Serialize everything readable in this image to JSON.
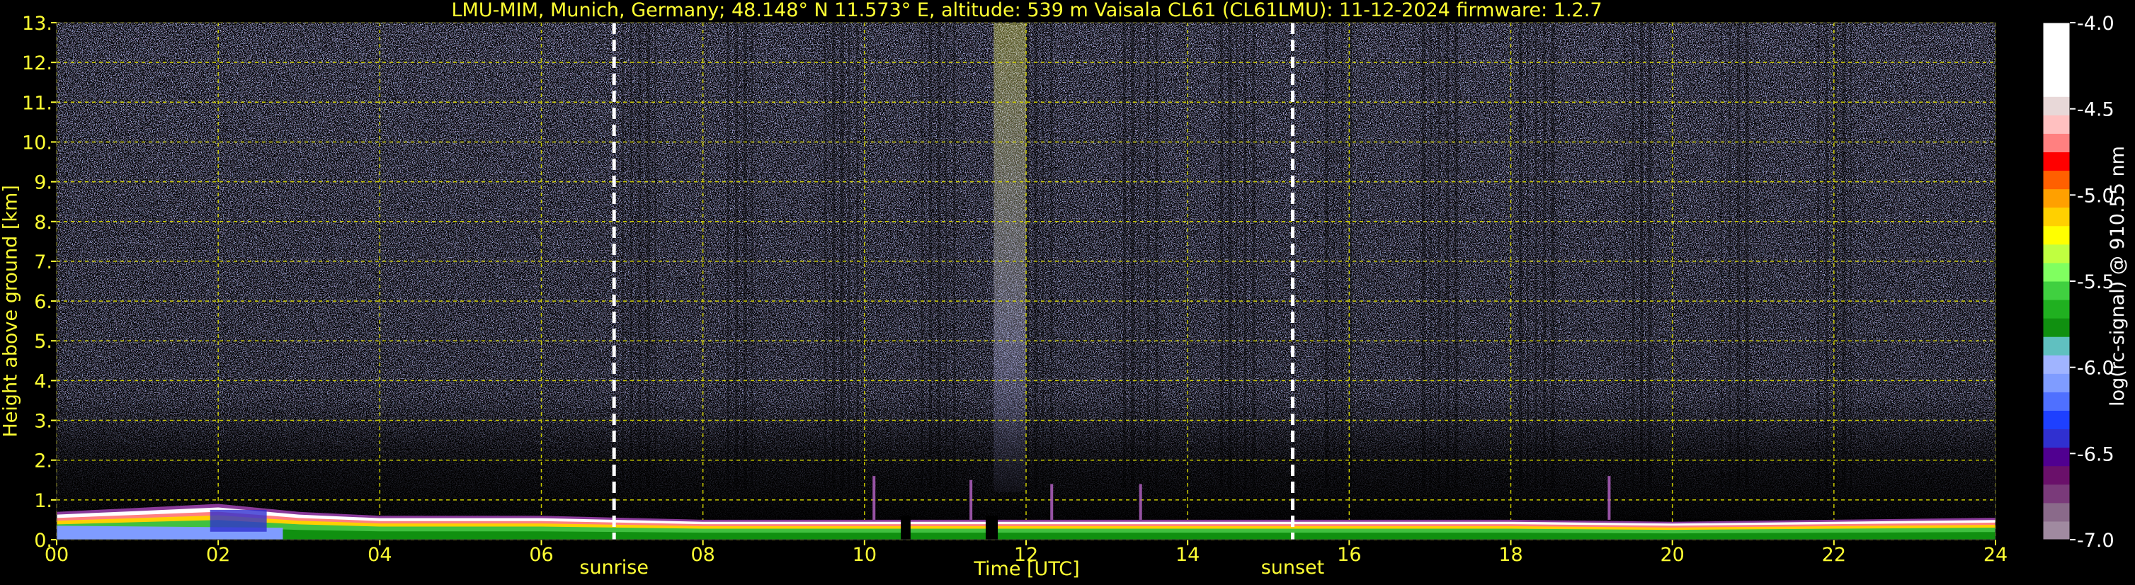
{
  "chart_data": {
    "type": "heatmap",
    "title": "LMU-MIM, Munich, Germany; 48.148° N 11.573° E, altitude: 539 m    Vaisala CL61 (CL61LMU): 11-12-2024    firmware: 1.2.7",
    "xlabel": "Time [UTC]",
    "ylabel": "Height above ground [km]",
    "xlim": [
      0,
      24
    ],
    "ylim": [
      0,
      13
    ],
    "x_ticks": [
      "00",
      "02",
      "04",
      "06",
      "08",
      "10",
      "12",
      "14",
      "16",
      "18",
      "20",
      "22",
      "24"
    ],
    "y_ticks": [
      "0.",
      "1.",
      "2.",
      "3.",
      "4.",
      "5.",
      "6.",
      "7.",
      "8.",
      "9.",
      "10.",
      "11.",
      "12.",
      "13."
    ],
    "grid": true,
    "events": [
      {
        "name": "sunrise",
        "time_utc": 6.9
      },
      {
        "name": "sunset",
        "time_utc": 15.3
      }
    ],
    "colorbar": {
      "label": "log(rc-signal) @ 910.55 nm",
      "range": [
        -7.0,
        -4.0
      ],
      "ticks": [
        "-7.0",
        "-6.5",
        "-6.0",
        "-5.5",
        "-5.0",
        "-4.5",
        "-4.0"
      ]
    },
    "boundary_layer_top_km": [
      {
        "t": 0,
        "h": 0.7
      },
      {
        "t": 1,
        "h": 0.8
      },
      {
        "t": 2,
        "h": 0.9
      },
      {
        "t": 3,
        "h": 0.7
      },
      {
        "t": 4,
        "h": 0.6
      },
      {
        "t": 6,
        "h": 0.6
      },
      {
        "t": 8,
        "h": 0.5
      },
      {
        "t": 10,
        "h": 0.5
      },
      {
        "t": 12,
        "h": 0.5
      },
      {
        "t": 14,
        "h": 0.5
      },
      {
        "t": 16,
        "h": 0.5
      },
      {
        "t": 18,
        "h": 0.5
      },
      {
        "t": 20,
        "h": 0.45
      },
      {
        "t": 22,
        "h": 0.5
      },
      {
        "t": 24,
        "h": 0.55
      }
    ],
    "noise_band_km": [
      2.0,
      13.0
    ],
    "high_signal_column_utc": [
      11.6,
      12.0
    ]
  },
  "colors": {
    "background": "#000000",
    "text": "#ffff33",
    "grid": "#cccc00",
    "colormap": [
      "#a08aa0",
      "#8a6a8a",
      "#7a3a7a",
      "#6a106a",
      "#500090",
      "#3030d0",
      "#1e40ff",
      "#4f70ff",
      "#7f9cff",
      "#a0b4ff",
      "#60c0c0",
      "#109010",
      "#20b020",
      "#40d040",
      "#80ff60",
      "#c0ff40",
      "#ffff00",
      "#ffd000",
      "#ffa000",
      "#ff6000",
      "#ff0000",
      "#ff8080",
      "#ffc0c0",
      "#e8d8d8",
      "#ffffff",
      "#ffffff",
      "#ffffff",
      "#ffffff"
    ]
  }
}
